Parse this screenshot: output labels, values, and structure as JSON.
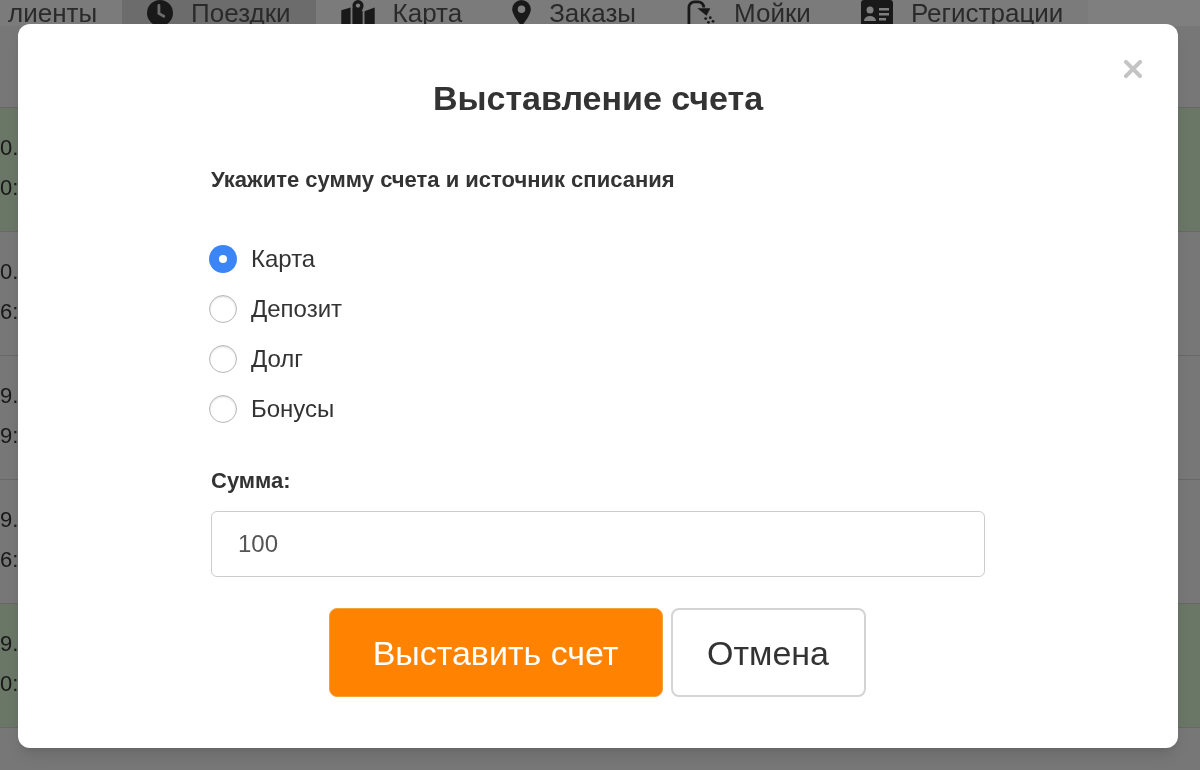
{
  "nav": {
    "tabs": [
      {
        "label": "лиенты",
        "selected": false
      },
      {
        "label": "Поездки",
        "selected": true
      },
      {
        "label": "Карта",
        "selected": false
      },
      {
        "label": "Заказы",
        "selected": false
      },
      {
        "label": "Мойки",
        "selected": false
      },
      {
        "label": "Регистрации",
        "selected": false
      }
    ]
  },
  "table": {
    "rows": [
      {
        "highlighted": true,
        "column_1": [
          "0.",
          "0:"
        ]
      },
      {
        "highlighted": false,
        "column_1": [
          "0.",
          "6:"
        ]
      },
      {
        "highlighted": false,
        "column_1": [
          "9.",
          "9:"
        ]
      },
      {
        "highlighted": false,
        "column_1": [
          "9.",
          "6:"
        ]
      },
      {
        "highlighted": true,
        "column_1": [
          "9.",
          "0:"
        ]
      }
    ]
  },
  "dialog": {
    "title": "Выставление счета",
    "prompt": "Укажите сумму счета и источник списания",
    "sources": [
      {
        "label": "Карта",
        "selected": true
      },
      {
        "label": "Депозит",
        "selected": false
      },
      {
        "label": "Долг",
        "selected": false
      },
      {
        "label": "Бонусы",
        "selected": false
      }
    ],
    "amount": {
      "label": "Сумма:",
      "value": "100"
    },
    "buttons": [
      {
        "label": "Выставить счет",
        "kind": "primary"
      },
      {
        "label": "Отмена",
        "kind": "default"
      }
    ]
  }
}
